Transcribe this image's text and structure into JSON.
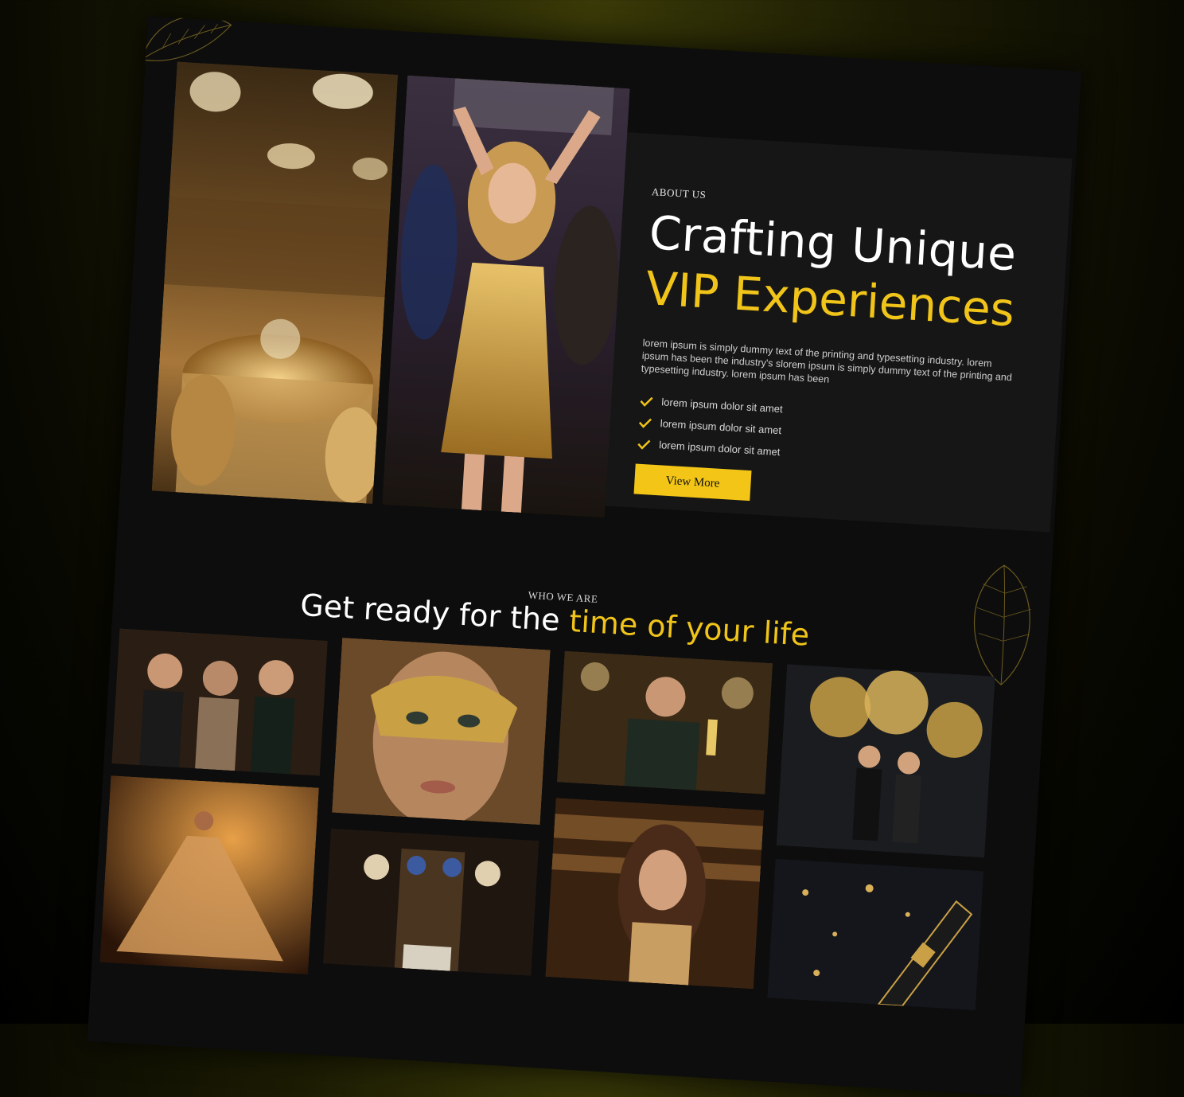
{
  "about": {
    "label": "ABOUT US",
    "title_line1": "Crafting Unique",
    "title_line2": "VIP Experiences",
    "body": "lorem ipsum is simply dummy text of the printing and typesetting industry. lorem ipsum has been the industry's slorem ipsum is simply dummy text of the printing and typesetting industry. lorem ipsum has been",
    "checklist": [
      "lorem ipsum dolor sit amet",
      "lorem ipsum dolor sit amet",
      "lorem ipsum dolor sit amet"
    ],
    "button_label": "View More"
  },
  "who": {
    "label": "WHO WE ARE",
    "title_plain": "Get ready for the ",
    "title_accent": "time of your life"
  },
  "colors": {
    "accent": "#f0c419",
    "background": "#0d0d0d",
    "panel": "#161616"
  },
  "icons": {
    "check": "check-icon",
    "leaf": "leaf-icon"
  }
}
